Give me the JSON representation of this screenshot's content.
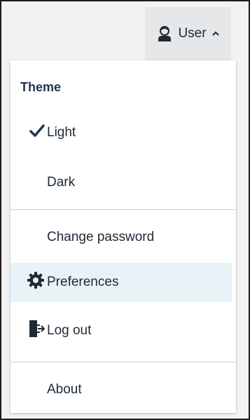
{
  "header": {
    "user_label": "User",
    "user_icon": "user-icon",
    "caret_icon": "chevron-up-icon"
  },
  "menu": {
    "theme_heading": "Theme",
    "theme_options": [
      {
        "label": "Light",
        "selected": true,
        "icon": "checkmark-icon"
      },
      {
        "label": "Dark",
        "selected": false
      }
    ],
    "items": [
      {
        "label": "Change password"
      },
      {
        "label": "Preferences",
        "icon": "gear-icon",
        "hovered": true
      },
      {
        "label": "Log out",
        "icon": "logout-icon"
      }
    ],
    "about_label": "About"
  },
  "colors": {
    "accent": "#1f3553",
    "hover_bg": "#e8f3f8",
    "topbar_bg": "#f2f2f2",
    "button_bg": "#e5e7e8"
  }
}
